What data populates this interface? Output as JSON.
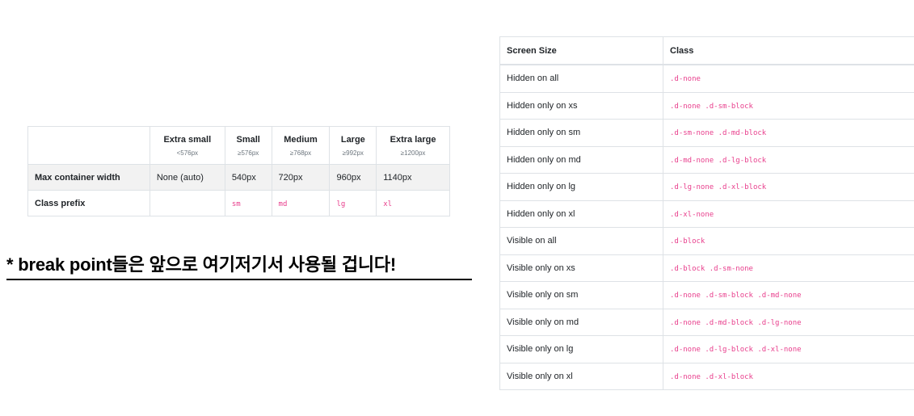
{
  "breakpoints": {
    "columns": [
      {
        "name": "Extra small",
        "range": "<576px"
      },
      {
        "name": "Small",
        "range": "≥576px"
      },
      {
        "name": "Medium",
        "range": "≥768px"
      },
      {
        "name": "Large",
        "range": "≥992px"
      },
      {
        "name": "Extra large",
        "range": "≥1200px"
      }
    ],
    "rows": [
      {
        "label": "Max container width",
        "values": [
          "None (auto)",
          "540px",
          "720px",
          "960px",
          "1140px"
        ]
      },
      {
        "label": "Class prefix",
        "values": [
          "",
          "sm",
          "md",
          "lg",
          "xl"
        ]
      }
    ]
  },
  "note": "* break point들은 앞으로 여기저기서 사용될 겁니다!",
  "visibility": {
    "headers": [
      "Screen Size",
      "Class"
    ],
    "rows": [
      {
        "size": "Hidden on all",
        "cls": ".d-none"
      },
      {
        "size": "Hidden only on xs",
        "cls": ".d-none .d-sm-block"
      },
      {
        "size": "Hidden only on sm",
        "cls": ".d-sm-none .d-md-block"
      },
      {
        "size": "Hidden only on md",
        "cls": ".d-md-none .d-lg-block"
      },
      {
        "size": "Hidden only on lg",
        "cls": ".d-lg-none .d-xl-block"
      },
      {
        "size": "Hidden only on xl",
        "cls": ".d-xl-none"
      },
      {
        "size": "Visible on all",
        "cls": ".d-block"
      },
      {
        "size": "Visible only on xs",
        "cls": ".d-block .d-sm-none"
      },
      {
        "size": "Visible only on sm",
        "cls": ".d-none .d-sm-block .d-md-none"
      },
      {
        "size": "Visible only on md",
        "cls": ".d-none .d-md-block .d-lg-none"
      },
      {
        "size": "Visible only on lg",
        "cls": ".d-none .d-lg-block .d-xl-none"
      },
      {
        "size": "Visible only on xl",
        "cls": ".d-none .d-xl-block"
      }
    ]
  },
  "colors": {
    "code": "#e83e8c",
    "border": "#dee2e6",
    "shaded_row": "#f2f2f2"
  }
}
